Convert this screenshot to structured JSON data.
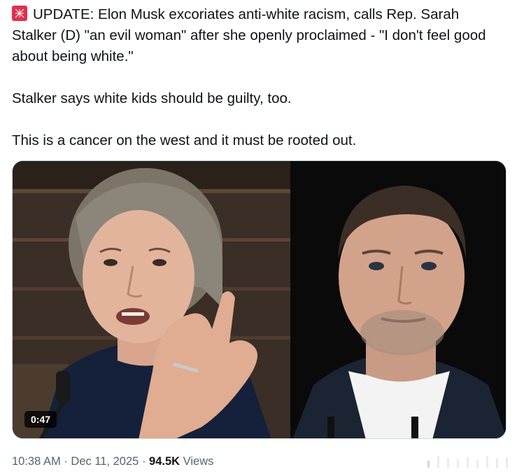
{
  "tweet": {
    "emoji_icon": "rotating-light-icon",
    "line1": "UPDATE: Elon Musk excoriates anti-white racism, calls Rep. Sarah Stalker (D) \"an evil woman\" after she openly proclaimed - \"I don't feel good about being white.\"",
    "line2": "Stalker says white kids should be guilty, too.",
    "line3": "This is a cancer on the west and it must be rooted out."
  },
  "media": {
    "duration": "0:47"
  },
  "meta": {
    "time": "10:38 AM",
    "sep1": "·",
    "date": "Dec 11, 2025",
    "sep2": "·",
    "views_count": "94.5K",
    "views_label": "Views"
  }
}
